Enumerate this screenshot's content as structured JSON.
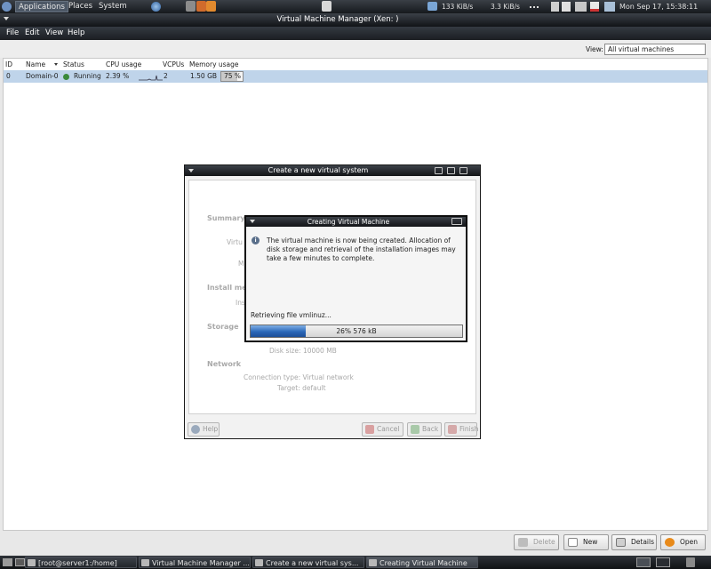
{
  "top_panel": {
    "menus": [
      "Applications",
      "Places",
      "System"
    ],
    "net_down": "133 KiB/s",
    "net_up": "3.3 KiB/s",
    "clock": "Mon Sep 17, 15:38:11"
  },
  "main_window": {
    "title": "Virtual Machine Manager (Xen:                    )",
    "menu": [
      "File",
      "Edit",
      "View",
      "Help"
    ],
    "view_label": "View:",
    "view_value": "All virtual machines",
    "columns": [
      "ID",
      "Name",
      "Status",
      "CPU usage",
      "VCPUs",
      "Memory usage"
    ],
    "vm": {
      "id": "0",
      "name": "Domain-0",
      "status": "Running",
      "cpu": "2.39 %",
      "vcpus": "2",
      "memory": "1.50 GB",
      "memory_pct": "75 %",
      "memory_fraction": 0.75
    },
    "buttons": {
      "delete": "Delete",
      "new": "New",
      "details": "Details",
      "open": "Open"
    }
  },
  "create_dialog": {
    "title": "Create a new virtual system",
    "summary_head": "Summary",
    "summary_virt": "Virtu",
    "summary_m": "M",
    "install_head": "Install me",
    "install_ins": "Ins",
    "storage_head": "Storage",
    "disk_size": "Disk size: 10000 MB",
    "network_head": "Network",
    "connection_type": "Connection type: Virtual network",
    "target": "Target: default",
    "buttons": {
      "help": "Help",
      "cancel": "Cancel",
      "back": "Back",
      "finish": "Finish"
    }
  },
  "progress_dialog": {
    "title": "Creating Virtual Machine",
    "message": "The virtual machine is now being created. Allocation of disk storage and retrieval of the installation images may take a few minutes to complete.",
    "status": "Retrieving file vmlinuz...",
    "progress_text": "26% 576 kB",
    "progress_fraction": 0.26
  },
  "taskbar": {
    "tasks": [
      "[root@server1:/home]",
      "Virtual Machine Manager ...",
      "Create a new virtual sys...",
      "Creating Virtual Machine"
    ]
  }
}
